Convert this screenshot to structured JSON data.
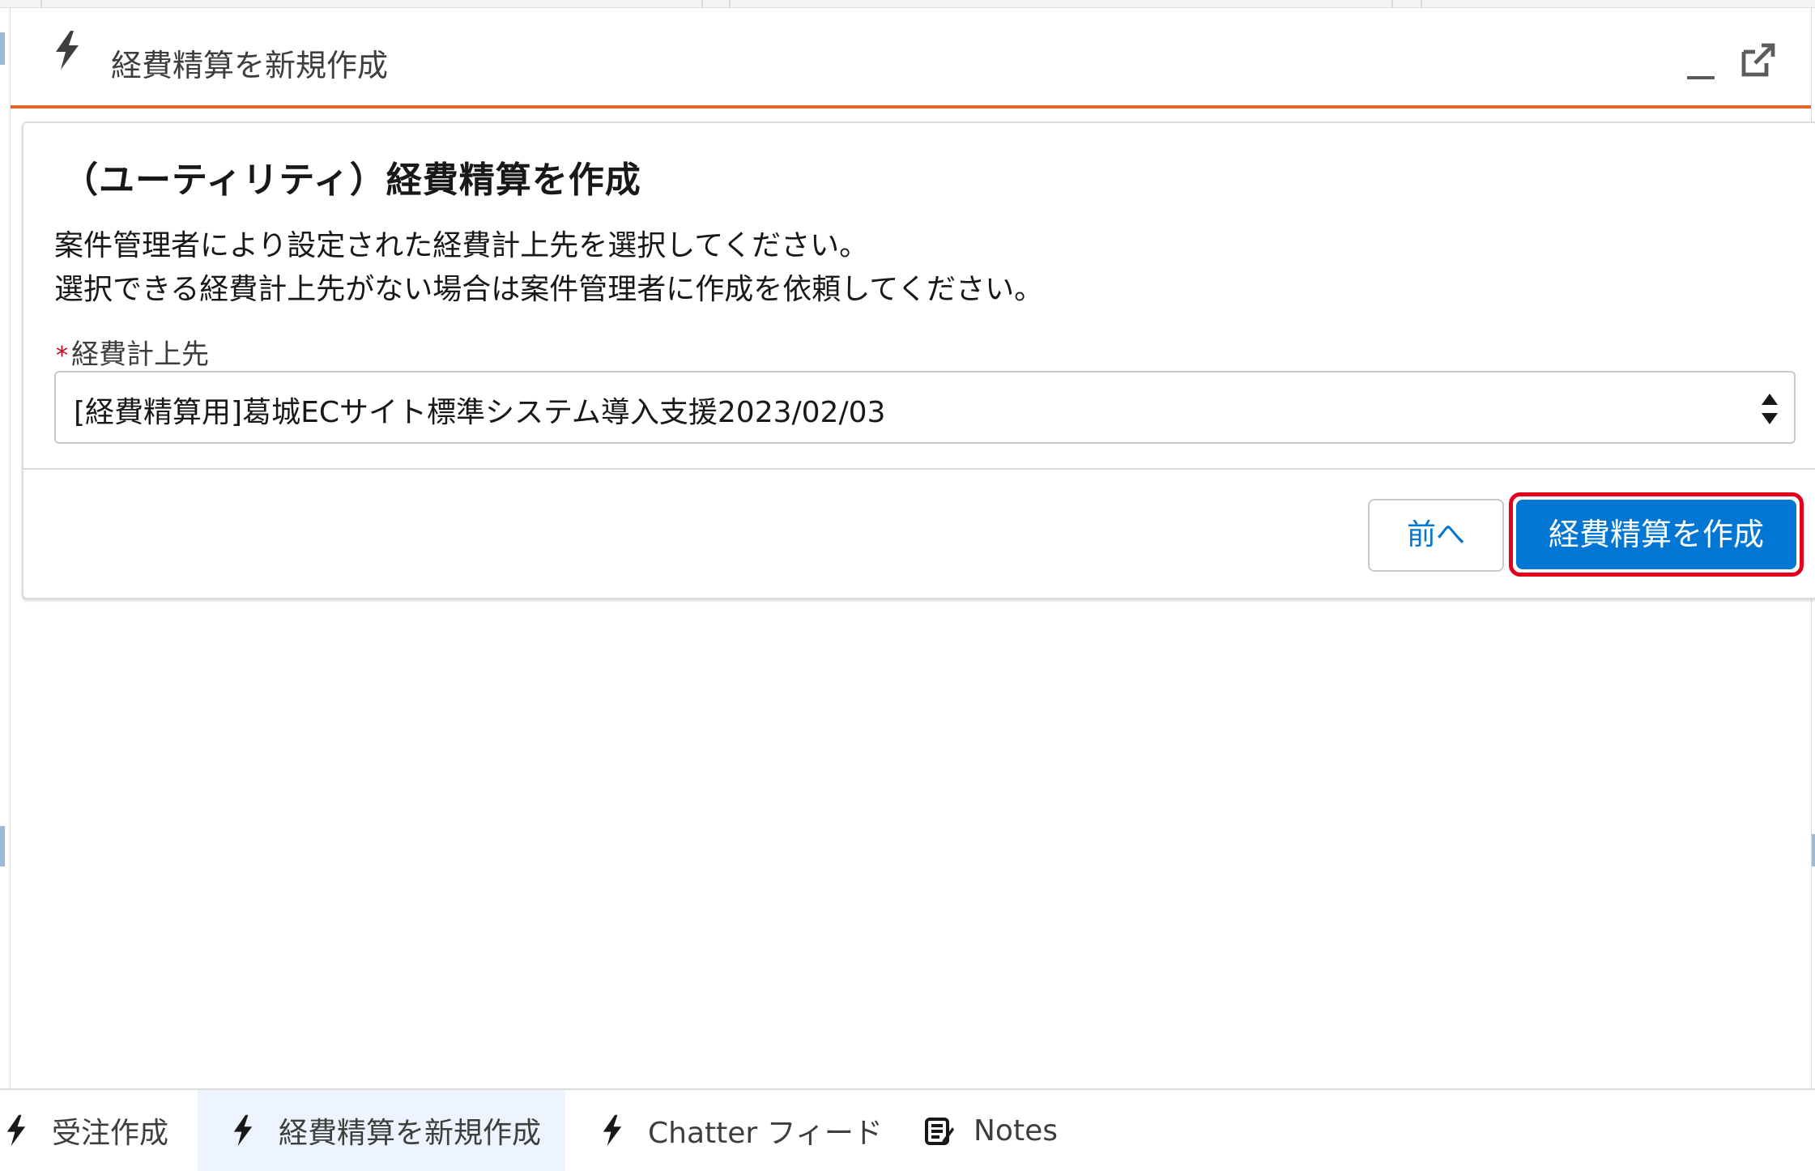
{
  "panel": {
    "title": "経費精算を新規作成"
  },
  "flow": {
    "heading": "（ユーティリティ）経費精算を作成",
    "description_line1": "案件管理者により設定された経費計上先を選択してください。",
    "description_line2": "選択できる経費計上先がない場合は案件管理者に作成を依頼してください。",
    "field": {
      "required_marker": "*",
      "label": "経費計上先",
      "selected_value": "[経費精算用]葛城ECサイト標準システム導入支援2023/02/03"
    },
    "buttons": {
      "previous_label": "前へ",
      "create_label": "経費精算を作成"
    }
  },
  "utility_bar": {
    "items": [
      {
        "label": "受注作成",
        "icon": "bolt-icon",
        "active": false
      },
      {
        "label": "経費精算を新規作成",
        "icon": "bolt-icon",
        "active": true
      },
      {
        "label": "Chatter フィード",
        "icon": "bolt-icon",
        "active": false
      },
      {
        "label": "Notes",
        "icon": "notes-icon",
        "active": false
      }
    ]
  },
  "colors": {
    "brand_blue": "#0176d3",
    "header_accent": "#e0662a",
    "highlight_red": "#e4001b",
    "required_red": "#ba0517"
  }
}
